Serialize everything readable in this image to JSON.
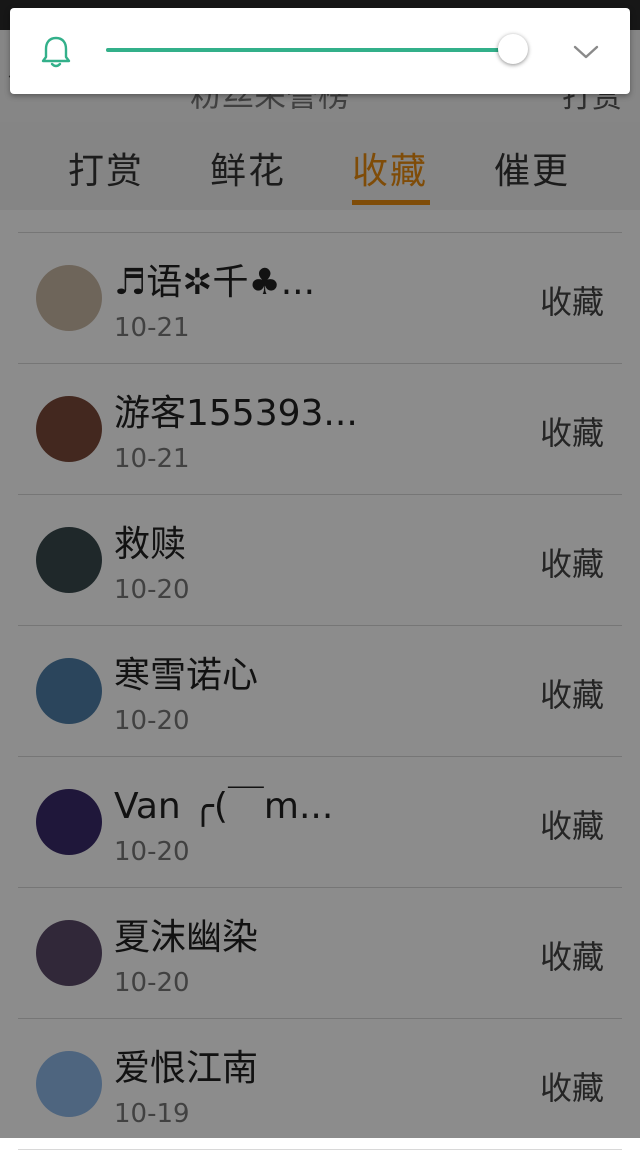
{
  "header": {
    "title": "粉丝荣誉榜",
    "right_action": "打赏"
  },
  "tabs": [
    {
      "label": "打赏",
      "active": false
    },
    {
      "label": "鲜花",
      "active": false
    },
    {
      "label": "收藏",
      "active": true
    },
    {
      "label": "催更",
      "active": false
    }
  ],
  "list": [
    {
      "name": "♬语✲千♣...",
      "date": "10-21",
      "action": "收藏",
      "avatar_color": "#c9b8a5"
    },
    {
      "name": "游客155393...",
      "date": "10-21",
      "action": "收藏",
      "avatar_color": "#7a4a3a"
    },
    {
      "name": "救赎",
      "date": "10-20",
      "action": "收藏",
      "avatar_color": "#3a4a4e"
    },
    {
      "name": "寒雪诺心",
      "date": "10-20",
      "action": "收藏",
      "avatar_color": "#4f7fa8"
    },
    {
      "name": "Van ╭(￣m...",
      "date": "10-20",
      "action": "收藏",
      "avatar_color": "#3a2a6a"
    },
    {
      "name": "夏沫幽染",
      "date": "10-20",
      "action": "收藏",
      "avatar_color": "#5a4a68"
    },
    {
      "name": "爱恨江南",
      "date": "10-19",
      "action": "收藏",
      "avatar_color": "#8eb8e8"
    }
  ],
  "volume": {
    "level": 0.97,
    "accent": "#33b08a"
  },
  "colors": {
    "accent_tab": "#e88a10"
  }
}
